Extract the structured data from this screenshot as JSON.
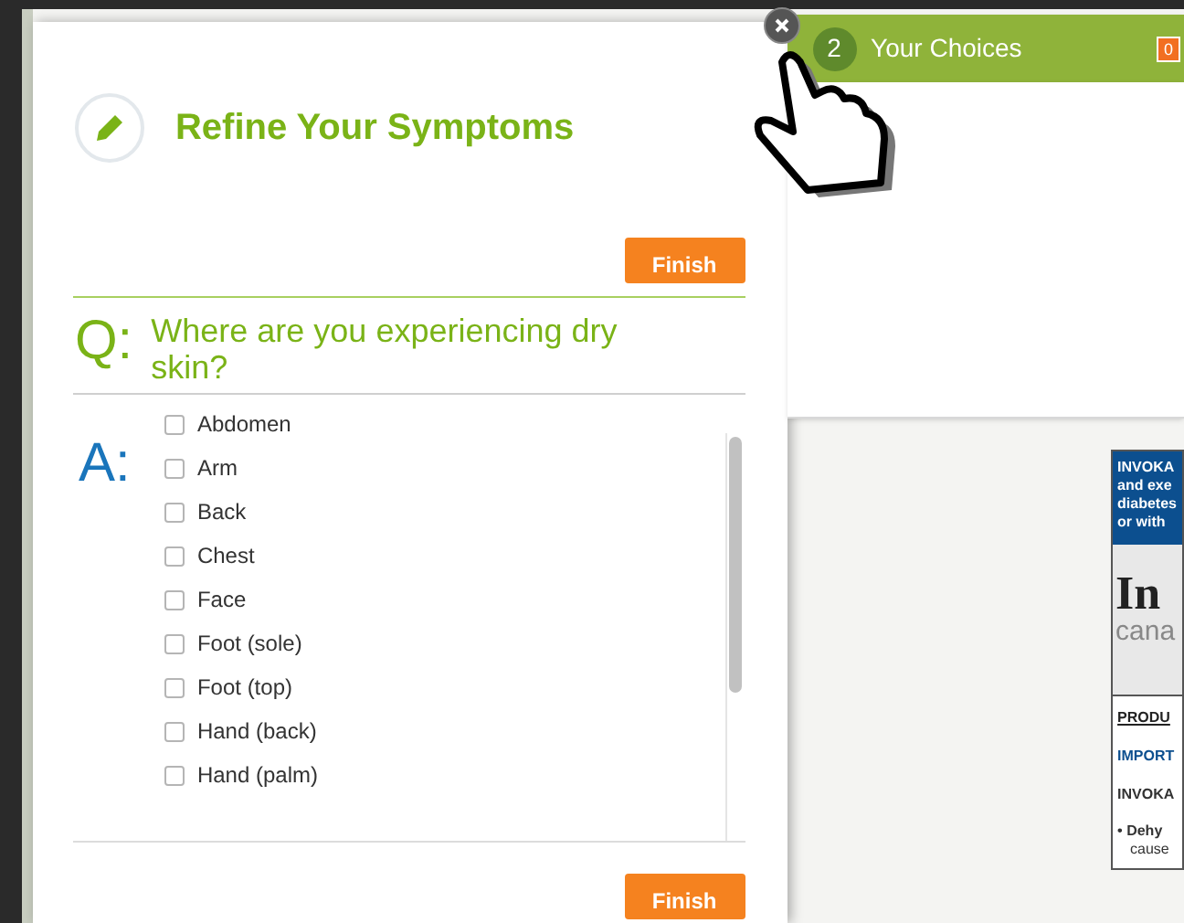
{
  "choices_bar": {
    "count": "2",
    "label": "Your Choices",
    "badge": "0"
  },
  "modal": {
    "title": "Refine Your Symptoms",
    "finish_top": "Finish",
    "question_prefix": "Q:",
    "question": "Where are you experiencing dry skin?",
    "answer_prefix": "A:",
    "options": [
      {
        "label": "Abdomen",
        "checked": false
      },
      {
        "label": "Arm",
        "checked": false
      },
      {
        "label": "Back",
        "checked": false
      },
      {
        "label": "Chest",
        "checked": false
      },
      {
        "label": "Face",
        "checked": false
      },
      {
        "label": "Foot (sole)",
        "checked": false
      },
      {
        "label": "Foot (top)",
        "checked": false
      },
      {
        "label": "Hand (back)",
        "checked": false
      },
      {
        "label": "Hand (palm)",
        "checked": false
      }
    ],
    "finish_bottom": "Finish"
  },
  "ad": {
    "header_lines": [
      "INVOKA",
      "and exe",
      "diabetes",
      "or with"
    ],
    "logo": "In",
    "logo_sub": "cana",
    "section_1": "PRODU",
    "section_2": "IMPORT",
    "section_3": "INVOKA",
    "bullet_mark": "•",
    "bullet_bold": "Dehy",
    "bullet_rest": "cause"
  }
}
